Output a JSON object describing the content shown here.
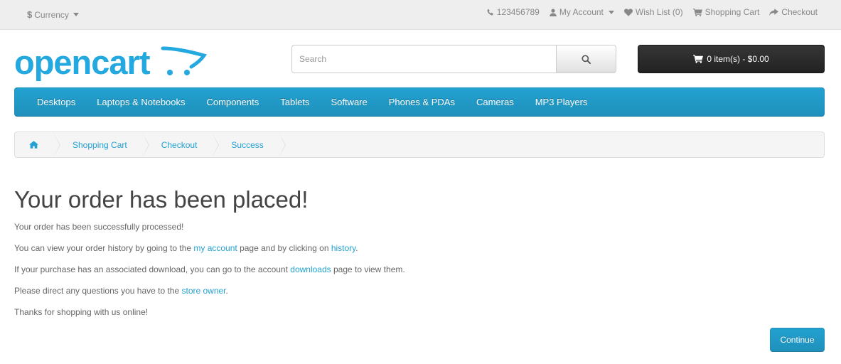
{
  "topbar": {
    "currency_symbol": "$",
    "currency_label": "Currency",
    "phone": "123456789",
    "my_account": "My Account",
    "wishlist": "Wish List (0)",
    "shopping_cart": "Shopping Cart",
    "checkout": "Checkout"
  },
  "header": {
    "logo_text": "opencart",
    "search_placeholder": "Search",
    "search_value": "",
    "cart_summary": "0 item(s) - $0.00"
  },
  "menu": {
    "items": [
      "Desktops",
      "Laptops & Notebooks",
      "Components",
      "Tablets",
      "Software",
      "Phones & PDAs",
      "Cameras",
      "MP3 Players"
    ]
  },
  "breadcrumb": {
    "items": [
      "Shopping Cart",
      "Checkout",
      "Success"
    ]
  },
  "content": {
    "title": "Your order has been placed!",
    "line1": "Your order has been successfully processed!",
    "line2_pre": "You can view your order history by going to the ",
    "line2_link1": "my account",
    "line2_mid": " page and by clicking on ",
    "line2_link2": "history",
    "line2_post": ".",
    "line3_pre": "If your purchase has an associated download, you can go to the account ",
    "line3_link": "downloads",
    "line3_post": " page to view them.",
    "line4_pre": "Please direct any questions you have to the ",
    "line4_link": "store owner",
    "line4_post": ".",
    "line5": "Thanks for shopping with us online!",
    "continue_label": "Continue"
  },
  "icons": {
    "home": "home-icon",
    "phone": "phone-icon",
    "user": "user-icon",
    "heart": "heart-icon",
    "cart": "cart-icon",
    "share": "share-icon",
    "search": "search-icon"
  },
  "colors": {
    "accent": "#23a1d1",
    "logo": "#23a8e0",
    "cart_button": "#2a2a2a"
  }
}
